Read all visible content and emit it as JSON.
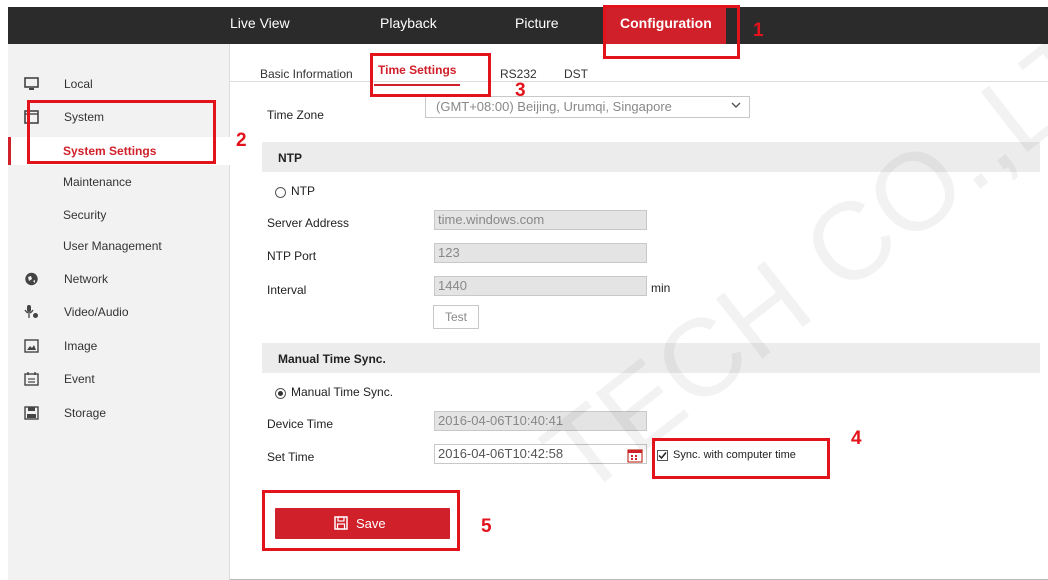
{
  "topnav": {
    "items": [
      "Live View",
      "Playback",
      "Picture",
      "Configuration"
    ],
    "active": "Configuration"
  },
  "sidebar": {
    "local": "Local",
    "system": "System",
    "system_settings": "System Settings",
    "maintenance": "Maintenance",
    "security": "Security",
    "user_management": "User Management",
    "network": "Network",
    "video_audio": "Video/Audio",
    "image": "Image",
    "event": "Event",
    "storage": "Storage"
  },
  "tabs": {
    "basic": "Basic Information",
    "time": "Time Settings",
    "rs232": "RS232",
    "dst": "DST"
  },
  "form": {
    "time_zone_label": "Time Zone",
    "time_zone_value": "(GMT+08:00) Beijing, Urumqi, Singapore",
    "ntp_section": "NTP",
    "ntp_radio": "NTP",
    "server_address_label": "Server Address",
    "server_address_value": "time.windows.com",
    "ntp_port_label": "NTP Port",
    "ntp_port_value": "123",
    "interval_label": "Interval",
    "interval_value": "1440",
    "interval_unit": "min",
    "test_button": "Test",
    "manual_section": "Manual Time Sync.",
    "manual_radio": "Manual Time Sync.",
    "device_time_label": "Device Time",
    "device_time_value": "2016-04-06T10:40:41",
    "set_time_label": "Set Time",
    "set_time_value": "2016-04-06T10:42:58",
    "sync_label": "Sync. with computer time",
    "save_button": "Save"
  },
  "annotations": [
    "1",
    "2",
    "3",
    "4",
    "5"
  ],
  "watermark": "TECH CO.,LTD",
  "colors": {
    "brand_red": "#d0202a",
    "nav_bg": "#2b2b2b",
    "annotation_red": "#e3131b"
  }
}
